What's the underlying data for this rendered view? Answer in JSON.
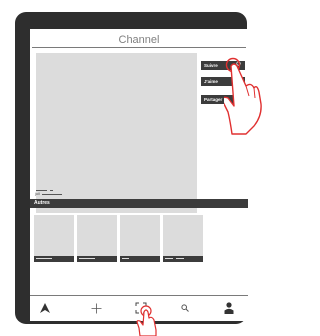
{
  "header": {
    "title": "Channel"
  },
  "actions": {
    "subscribe_label": "Suivre",
    "like_label": "J'aime",
    "share_label": "Partager"
  },
  "video_meta": {
    "date_text": "juil"
  },
  "section": {
    "title": "Autres"
  },
  "thumbnails": [
    {
      "id": 1
    },
    {
      "id": 2
    },
    {
      "id": 3
    },
    {
      "id": 4
    }
  ],
  "tabbar": {
    "items": [
      {
        "icon": "home-icon"
      },
      {
        "icon": "plus-icon"
      },
      {
        "icon": "scan-icon"
      },
      {
        "icon": "search-icon"
      },
      {
        "icon": "profile-icon"
      }
    ]
  },
  "colors": {
    "frame": "#2e2e2e",
    "placeholder": "#dcdcdc",
    "bar": "#3c3c3c",
    "accent": "#e03030"
  }
}
